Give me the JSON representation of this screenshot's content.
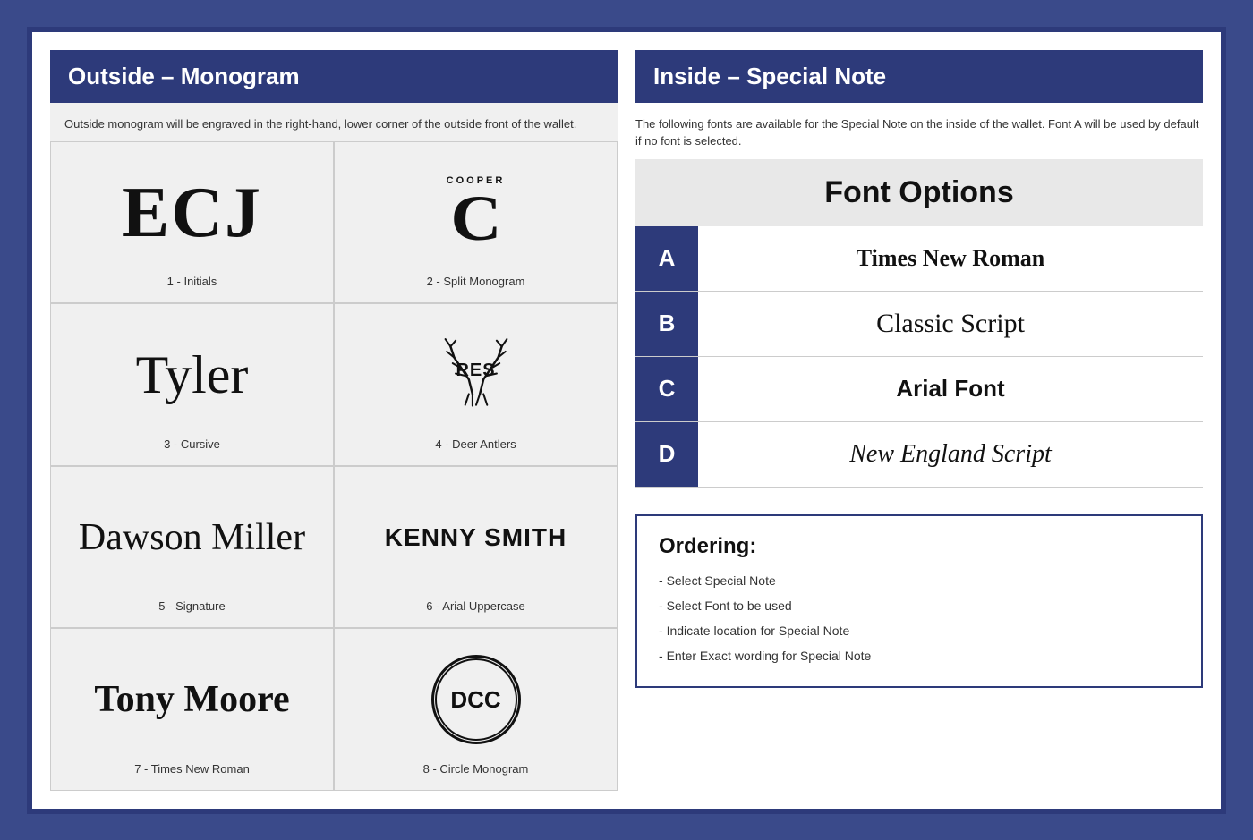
{
  "left": {
    "header": "Outside – Monogram",
    "description": "Outside monogram will be engraved in the right-hand, lower corner of the outside front of the wallet.",
    "monograms": [
      {
        "id": 1,
        "label": "1 - Initials",
        "type": "initials",
        "text": "ECJ"
      },
      {
        "id": 2,
        "label": "2 - Split Monogram",
        "type": "split",
        "text": "COOPER",
        "letter": "C"
      },
      {
        "id": 3,
        "label": "3 - Cursive",
        "type": "cursive",
        "text": "Tyler"
      },
      {
        "id": 4,
        "label": "4 - Deer Antlers",
        "type": "antlers",
        "text": "RES"
      },
      {
        "id": 5,
        "label": "5 - Signature",
        "type": "signature",
        "text": "Dawson Miller"
      },
      {
        "id": 6,
        "label": "6 - Arial Uppercase",
        "type": "arial-upper",
        "text": "KENNY SMITH"
      },
      {
        "id": 7,
        "label": "7 - Times New Roman",
        "type": "times",
        "text": "Tony Moore"
      },
      {
        "id": 8,
        "label": "8 - Circle Monogram",
        "type": "circle",
        "text": "DCC"
      }
    ]
  },
  "right": {
    "header": "Inside – Special Note",
    "description": "The following fonts are available for the Special Note on the inside of the wallet.  Font A will be used by default if no font is selected.",
    "font_options_title": "Font Options",
    "fonts": [
      {
        "letter": "A",
        "name": "Times New Roman",
        "class": "font-a"
      },
      {
        "letter": "B",
        "name": "Classic Script",
        "class": "font-b"
      },
      {
        "letter": "C",
        "name": "Arial Font",
        "class": "font-c"
      },
      {
        "letter": "D",
        "name": "New England Script",
        "class": "font-d"
      }
    ],
    "ordering": {
      "title": "Ordering:",
      "items": [
        "Select Special Note",
        "Select Font to be used",
        "Indicate location for Special Note",
        "Enter Exact wording for Special Note"
      ]
    }
  }
}
